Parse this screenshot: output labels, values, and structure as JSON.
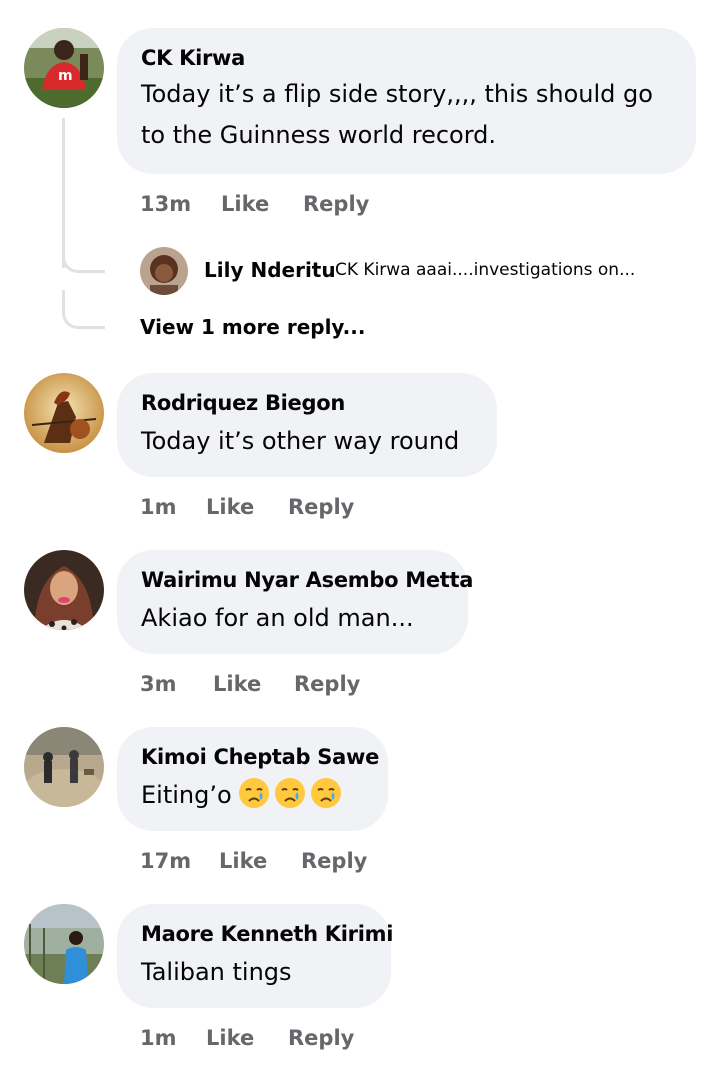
{
  "actions": {
    "like": "Like",
    "reply": "Reply"
  },
  "comments": [
    {
      "name": "CK Kirwa",
      "text_line1": "Today it’s a flip side story,,,, this should go",
      "text_line2": "to the Guinness world record.",
      "time": "13m",
      "reply_preview": {
        "name": "Lily Nderitu",
        "snippet": "CK Kirwa aaai....investigations on..."
      },
      "more_replies": "View 1 more reply..."
    },
    {
      "name": "Rodriquez Biegon",
      "text": "Today it’s other way round",
      "time": "1m"
    },
    {
      "name": "Wairimu Nyar Asembo Metta",
      "text": "Akiao for an old man...",
      "time": "3m"
    },
    {
      "name": "Kimoi Cheptab Sawe",
      "text": "Eiting’o",
      "emoji": "crying-face-emoji x3",
      "time": "17m"
    },
    {
      "name": "Maore Kenneth Kirimi",
      "text": "Taliban tings",
      "time": "1m"
    }
  ],
  "colors": {
    "bubble": "#f0f2f5",
    "action_text": "#65676b",
    "thread_line": "#dfe1e5"
  }
}
